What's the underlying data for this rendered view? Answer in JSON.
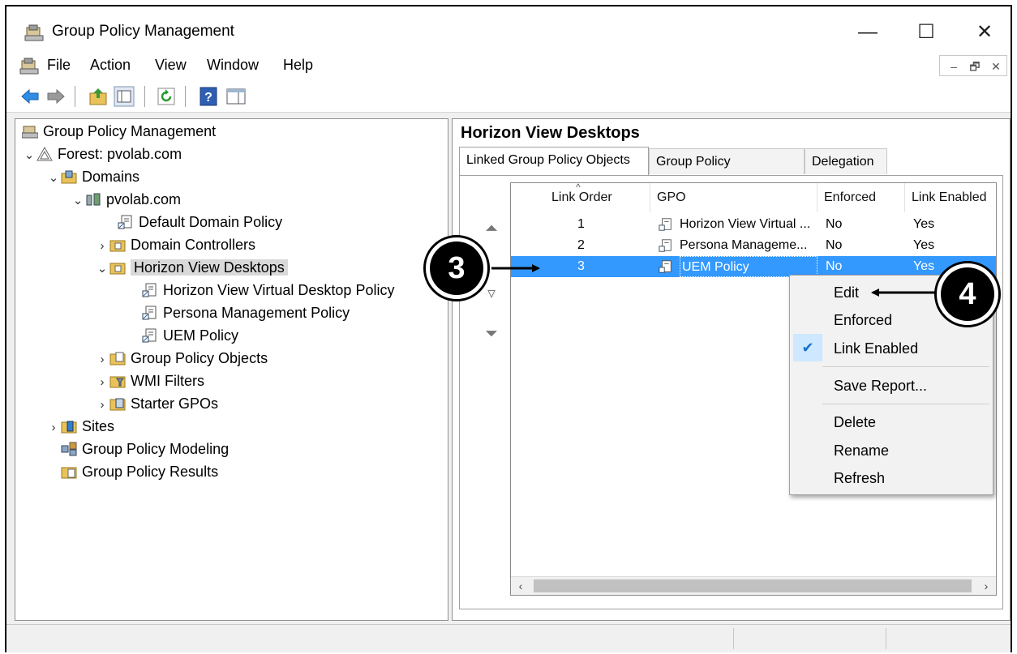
{
  "window": {
    "title": "Group Policy Management",
    "controls": {
      "minimize": "—",
      "maximize": "☐",
      "close": "✕"
    }
  },
  "menubar": {
    "items": [
      "File",
      "Action",
      "View",
      "Window",
      "Help"
    ],
    "mdi_controls": [
      "–",
      "🗗",
      "✕"
    ]
  },
  "toolbar": {
    "buttons": [
      "back-arrow-icon",
      "forward-arrow-icon",
      "up-folder-icon",
      "show-hide-tree-icon",
      "refresh-icon",
      "help-icon",
      "action-pane-icon"
    ]
  },
  "tree": {
    "root": "Group Policy Management",
    "forest": "Forest: pvolab.com",
    "domains": "Domains",
    "domain": "pvolab.com",
    "default_domain_policy": "Default Domain Policy",
    "domain_controllers": "Domain Controllers",
    "horizon_view_desktops": "Horizon View Desktops",
    "hv_virtual_desktop_policy": "Horizon View Virtual Desktop Policy",
    "persona_management_policy": "Persona Management Policy",
    "uem_policy": "UEM Policy",
    "group_policy_objects": "Group Policy Objects",
    "wmi_filters": "WMI Filters",
    "starter_gpos": "Starter GPOs",
    "sites": "Sites",
    "gp_modeling": "Group Policy Modeling",
    "gp_results": "Group Policy Results"
  },
  "detail": {
    "title": "Horizon View Desktops",
    "tabs": [
      "Linked Group Policy Objects",
      "Group Policy Inheritance",
      "Delegation"
    ],
    "columns": [
      "Link Order",
      "GPO",
      "Enforced",
      "Link Enabled"
    ],
    "rows": [
      {
        "order": "1",
        "gpo": "Horizon View Virtual ...",
        "enforced": "No",
        "enabled": "Yes"
      },
      {
        "order": "2",
        "gpo": "Persona Manageme...",
        "enforced": "No",
        "enabled": "Yes"
      },
      {
        "order": "3",
        "gpo": "UEM Policy",
        "enforced": "No",
        "enabled": "Yes"
      }
    ],
    "selected_row": 3
  },
  "context_menu": {
    "items": [
      "Edit",
      "Enforced",
      "Link Enabled",
      "Save Report...",
      "Delete",
      "Rename",
      "Refresh"
    ],
    "checked": "Link Enabled"
  },
  "callouts": {
    "step3": "3",
    "step4": "4"
  },
  "colors": {
    "selection": "#3399ff",
    "tree_selected": "#d9d9d9",
    "check_highlight": "#cde8ff"
  }
}
